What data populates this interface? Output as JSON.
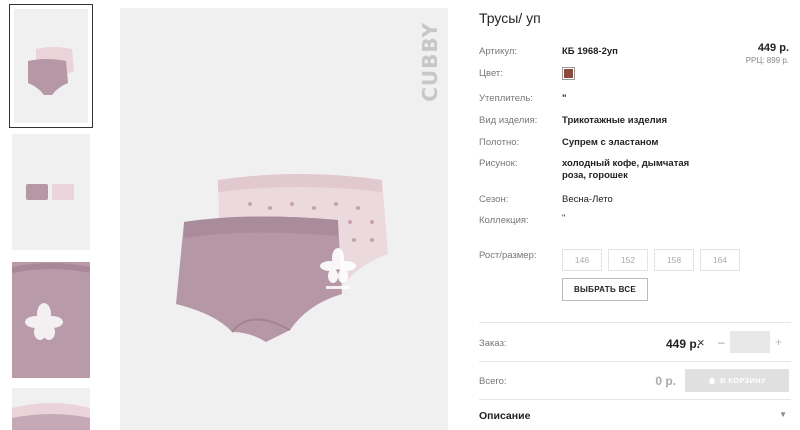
{
  "product": {
    "title": "Трусы/ уп",
    "price": "449 р.",
    "rrp": "РРЦ: 899 р.",
    "brand": "CUBBY",
    "color_hex": "#8a4a3c"
  },
  "attributes": [
    {
      "label": "Артикул:",
      "value": "КБ 1968-2уп"
    },
    {
      "label": "Цвет:",
      "value": ""
    },
    {
      "label": "Утеплитель:",
      "value": "\""
    },
    {
      "label": "Вид изделия:",
      "value": "Трикотажные изделия"
    },
    {
      "label": "Полотно:",
      "value": "Супрем с эластаном"
    },
    {
      "label": "Рисунок:",
      "value": "холодный кофе, дымчатая роза, горошек"
    },
    {
      "label": "Сезон:",
      "value": "Весна-Лето"
    },
    {
      "label": "Коллекция:",
      "value": "\""
    }
  ],
  "sizes": {
    "label": "Рост/размер:",
    "options": [
      "146",
      "152",
      "158",
      "164"
    ],
    "select_all": "ВЫБРАТЬ ВСЕ"
  },
  "order": {
    "label": "Заказ:",
    "price": "449 р.",
    "times": "×",
    "minus": "–",
    "plus": "+",
    "quantity": ""
  },
  "total": {
    "label": "Всего:",
    "price": "0 р.",
    "cart_button": "В КОРЗИНУ"
  },
  "description": {
    "label": "Описание"
  }
}
